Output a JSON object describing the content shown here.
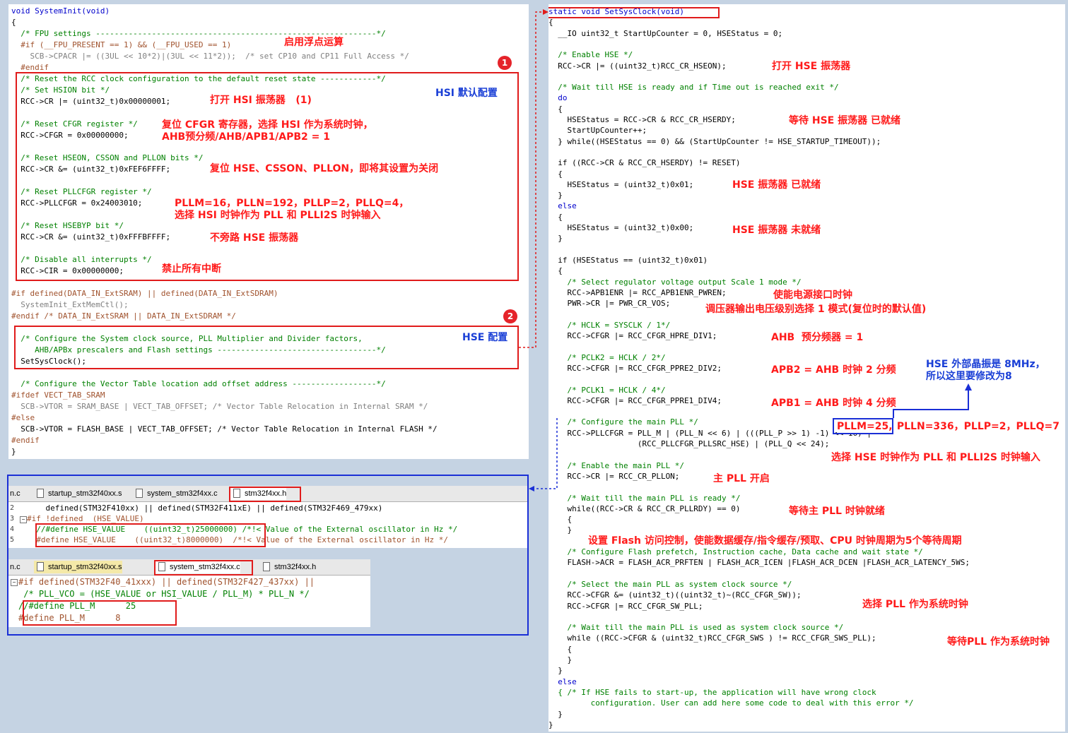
{
  "left_panel": {
    "lines": [
      {
        "t": "void SystemInit(void)",
        "c": "kw"
      },
      {
        "t": "{",
        "c": "tx"
      },
      {
        "t": "  /* FPU settings ------------------------------------------------------------*/",
        "c": "cm"
      },
      {
        "t": "  #if (__FPU_PRESENT == 1) && (__FPU_USED == 1)",
        "c": "pp"
      },
      {
        "t": "    SCB->CPACR |= ((3UL << 10*2)|(3UL << 11*2));  /* set CP10 and CP11 Full Access */",
        "c": "gr"
      },
      {
        "t": "  #endif",
        "c": "pp"
      },
      {
        "t": "  /* Reset the RCC clock configuration to the default reset state ------------*/",
        "c": "cm"
      },
      {
        "t": "  /* Set HSION bit */",
        "c": "cm"
      },
      {
        "t": "  RCC->CR |= (uint32_t)0x00000001;",
        "c": "tx"
      },
      {
        "t": "",
        "c": "tx"
      },
      {
        "t": "  /* Reset CFGR register */",
        "c": "cm"
      },
      {
        "t": "  RCC->CFGR = 0x00000000;",
        "c": "tx"
      },
      {
        "t": "",
        "c": "tx"
      },
      {
        "t": "  /* Reset HSEON, CSSON and PLLON bits */",
        "c": "cm"
      },
      {
        "t": "  RCC->CR &= (uint32_t)0xFEF6FFFF;",
        "c": "tx"
      },
      {
        "t": "",
        "c": "tx"
      },
      {
        "t": "  /* Reset PLLCFGR register */",
        "c": "cm"
      },
      {
        "t": "  RCC->PLLCFGR = 0x24003010;",
        "c": "tx"
      },
      {
        "t": "",
        "c": "tx"
      },
      {
        "t": "  /* Reset HSEBYP bit */",
        "c": "cm"
      },
      {
        "t": "  RCC->CR &= (uint32_t)0xFFFBFFFF;",
        "c": "tx"
      },
      {
        "t": "",
        "c": "tx"
      },
      {
        "t": "  /* Disable all interrupts */",
        "c": "cm"
      },
      {
        "t": "  RCC->CIR = 0x00000000;",
        "c": "tx"
      },
      {
        "t": "",
        "c": "tx"
      },
      {
        "t": "#if defined(DATA_IN_ExtSRAM) || defined(DATA_IN_ExtSDRAM)",
        "c": "pp"
      },
      {
        "t": "  SystemInit_ExtMemCtl();",
        "c": "gr"
      },
      {
        "t": "#endif /* DATA_IN_ExtSRAM || DATA_IN_ExtSDRAM */",
        "c": "pp"
      },
      {
        "t": "",
        "c": "tx"
      },
      {
        "t": "  /* Configure the System clock source, PLL Multiplier and Divider factors,",
        "c": "cm"
      },
      {
        "t": "     AHB/APBx prescalers and Flash settings ----------------------------------*/",
        "c": "cm"
      },
      {
        "t": "  SetSysClock();",
        "c": "tx"
      },
      {
        "t": "",
        "c": "tx"
      },
      {
        "t": "  /* Configure the Vector Table location add offset address ------------------*/",
        "c": "cm"
      },
      {
        "t": "#ifdef VECT_TAB_SRAM",
        "c": "pp"
      },
      {
        "t": "  SCB->VTOR = SRAM_BASE | VECT_TAB_OFFSET; /* Vector Table Relocation in Internal SRAM */",
        "c": "gr"
      },
      {
        "t": "#else",
        "c": "pp"
      },
      {
        "t": "  SCB->VTOR = FLASH_BASE | VECT_TAB_OFFSET; /* Vector Table Relocation in Internal FLASH */",
        "c": "tx"
      },
      {
        "t": "#endif",
        "c": "pp"
      },
      {
        "t": "}",
        "c": "tx"
      }
    ],
    "annotations": {
      "fpu": "启用浮点运算",
      "hsi_on": "打开 HSI 振荡器   (1)",
      "hsi_title": "HSI 默认配置",
      "cfgr": "复位 CFGR 寄存器，选择 HSI 作为系统时钟，\nAHB预分频/AHB/APB1/APB2 = 1",
      "hseon": "复位 HSE、CSSON、PLLON，即将其设置为关闭",
      "pllcfgr": "PLLM=16，PLLN=192，PLLP=2，PLLQ=4，\n选择 HSI 时钟作为 PLL 和 PLLI2S 时钟输入",
      "hsebyp": "不旁路 HSE 振荡器",
      "cir": "禁止所有中断",
      "hse_title": "HSE 配置"
    },
    "badges": [
      "1",
      "2"
    ]
  },
  "right_panel": {
    "lines": [
      {
        "t": "static void SetSysClock(void)",
        "c": "kw"
      },
      {
        "t": "{",
        "c": "tx"
      },
      {
        "t": "  __IO uint32_t StartUpCounter = 0, HSEStatus = 0;",
        "c": "tx"
      },
      {
        "t": "",
        "c": "tx"
      },
      {
        "t": "  /* Enable HSE */",
        "c": "cm"
      },
      {
        "t": "  RCC->CR |= ((uint32_t)RCC_CR_HSEON);",
        "c": "tx"
      },
      {
        "t": "",
        "c": "tx"
      },
      {
        "t": "  /* Wait till HSE is ready and if Time out is reached exit */",
        "c": "cm"
      },
      {
        "t": "  do",
        "c": "kw"
      },
      {
        "t": "  {",
        "c": "tx"
      },
      {
        "t": "    HSEStatus = RCC->CR & RCC_CR_HSERDY;",
        "c": "tx"
      },
      {
        "t": "    StartUpCounter++;",
        "c": "tx"
      },
      {
        "t": "  } while((HSEStatus == 0) && (StartUpCounter != HSE_STARTUP_TIMEOUT));",
        "c": "tx"
      },
      {
        "t": "",
        "c": "tx"
      },
      {
        "t": "  if ((RCC->CR & RCC_CR_HSERDY) != RESET)",
        "c": "tx"
      },
      {
        "t": "  {",
        "c": "tx"
      },
      {
        "t": "    HSEStatus = (uint32_t)0x01;",
        "c": "tx"
      },
      {
        "t": "  }",
        "c": "tx"
      },
      {
        "t": "  else",
        "c": "kw"
      },
      {
        "t": "  {",
        "c": "tx"
      },
      {
        "t": "    HSEStatus = (uint32_t)0x00;",
        "c": "tx"
      },
      {
        "t": "  }",
        "c": "tx"
      },
      {
        "t": "",
        "c": "tx"
      },
      {
        "t": "  if (HSEStatus == (uint32_t)0x01)",
        "c": "tx"
      },
      {
        "t": "  {",
        "c": "tx"
      },
      {
        "t": "    /* Select regulator voltage output Scale 1 mode */",
        "c": "cm"
      },
      {
        "t": "    RCC->APB1ENR |= RCC_APB1ENR_PWREN;",
        "c": "tx"
      },
      {
        "t": "    PWR->CR |= PWR_CR_VOS;",
        "c": "tx"
      },
      {
        "t": "",
        "c": "tx"
      },
      {
        "t": "    /* HCLK = SYSCLK / 1*/",
        "c": "cm"
      },
      {
        "t": "    RCC->CFGR |= RCC_CFGR_HPRE_DIV1;",
        "c": "tx"
      },
      {
        "t": "",
        "c": "tx"
      },
      {
        "t": "    /* PCLK2 = HCLK / 2*/",
        "c": "cm"
      },
      {
        "t": "    RCC->CFGR |= RCC_CFGR_PPRE2_DIV2;",
        "c": "tx"
      },
      {
        "t": "",
        "c": "tx"
      },
      {
        "t": "    /* PCLK1 = HCLK / 4*/",
        "c": "cm"
      },
      {
        "t": "    RCC->CFGR |= RCC_CFGR_PPRE1_DIV4;",
        "c": "tx"
      },
      {
        "t": "",
        "c": "tx"
      },
      {
        "t": "    /* Configure the main PLL */",
        "c": "cm"
      },
      {
        "t": "    RCC->PLLCFGR = PLL_M | (PLL_N << 6) | (((PLL_P >> 1) -1) << 16) |",
        "c": "tx"
      },
      {
        "t": "                   (RCC_PLLCFGR_PLLSRC_HSE) | (PLL_Q << 24);",
        "c": "tx"
      },
      {
        "t": "",
        "c": "tx"
      },
      {
        "t": "    /* Enable the main PLL */",
        "c": "cm"
      },
      {
        "t": "    RCC->CR |= RCC_CR_PLLON;",
        "c": "tx"
      },
      {
        "t": "",
        "c": "tx"
      },
      {
        "t": "    /* Wait till the main PLL is ready */",
        "c": "cm"
      },
      {
        "t": "    while((RCC->CR & RCC_CR_PLLRDY) == 0)",
        "c": "tx"
      },
      {
        "t": "    {",
        "c": "tx"
      },
      {
        "t": "    }",
        "c": "tx"
      },
      {
        "t": "",
        "c": "tx"
      },
      {
        "t": "    /* Configure Flash prefetch, Instruction cache, Data cache and wait state */",
        "c": "cm"
      },
      {
        "t": "    FLASH->ACR = FLASH_ACR_PRFTEN | FLASH_ACR_ICEN |FLASH_ACR_DCEN |FLASH_ACR_LATENCY_5WS;",
        "c": "tx"
      },
      {
        "t": "",
        "c": "tx"
      },
      {
        "t": "    /* Select the main PLL as system clock source */",
        "c": "cm"
      },
      {
        "t": "    RCC->CFGR &= (uint32_t)((uint32_t)~(RCC_CFGR_SW));",
        "c": "tx"
      },
      {
        "t": "    RCC->CFGR |= RCC_CFGR_SW_PLL;",
        "c": "tx"
      },
      {
        "t": "",
        "c": "tx"
      },
      {
        "t": "    /* Wait till the main PLL is used as system clock source */",
        "c": "cm"
      },
      {
        "t": "    while ((RCC->CFGR & (uint32_t)RCC_CFGR_SWS ) != RCC_CFGR_SWS_PLL);",
        "c": "tx"
      },
      {
        "t": "    {",
        "c": "tx"
      },
      {
        "t": "    }",
        "c": "tx"
      },
      {
        "t": "  }",
        "c": "tx"
      },
      {
        "t": "  else",
        "c": "kw"
      },
      {
        "t": "  { /* If HSE fails to start-up, the application will have wrong clock",
        "c": "cm"
      },
      {
        "t": "         configuration. User can add here some code to deal with this error */",
        "c": "cm"
      },
      {
        "t": "  }",
        "c": "tx"
      },
      {
        "t": "}",
        "c": "tx"
      }
    ],
    "annotations": {
      "hse_on": "打开 HSE 振荡器",
      "hse_ready1": "等待 HSE 振荡器 已就绪",
      "hse_ready2": "HSE 振荡器 已就绪",
      "hse_notready": "HSE 振荡器 未就绪",
      "pwr_clk": "使能电源接口时钟",
      "vos": "调压器输出电压级别选择 1 模式(复位时的默认值)",
      "ahb": "AHB  预分频器 = 1",
      "apb2": "APB2 = AHB 时钟 2 分频",
      "apb1": "APB1 = AHB 时钟 4 分频",
      "pllm": "PLLM=25,",
      "pll_rest": " PLLN=336，PLLP=2，PLLQ=7",
      "pll_src": "选择 HSE 时钟作为 PLL 和 PLLI2S 时钟输入",
      "pll_on": "主 PLL 开启",
      "pll_ready": "等待主 PLL 时钟就绪",
      "flash": "设置 Flash 访问控制，使能数据缓存/指令缓存/预取、CPU 时钟周期为5个等待周期",
      "sw_pll": "选择 PLL 作为系统时钟",
      "sws_wait": "等待PLL 作为系统时钟",
      "hse_xtal": "HSE 外部晶振是 8MHz，\n所以这里要修改为8"
    }
  },
  "bottom_panel": {
    "tabs1": [
      {
        "label": "n.c",
        "style": "plain"
      },
      {
        "label": "startup_stm32f40xx.s",
        "style": "plain"
      },
      {
        "label": "system_stm32f4xx.c",
        "style": "plain"
      },
      {
        "label": "stm32f4xx.h",
        "style": "active"
      }
    ],
    "lines1": [
      {
        "n": "2",
        "t": "    defined(STM32F410xx) || defined(STM32F411xE) || defined(STM32F469_479xx)",
        "c": "tx"
      },
      {
        "n": "3",
        "t": "#if !defined  (HSE_VALUE)",
        "c": "pp"
      },
      {
        "n": "4",
        "t": "  //#define HSE_VALUE    ((uint32_t)25000000) /*!< Value of the External oscillator in Hz */",
        "c": "cm"
      },
      {
        "n": "5",
        "t": "  #define HSE_VALUE    ((uint32_t)8000000)  /*!< Value of the External oscillator in Hz */",
        "c": "pp"
      }
    ],
    "tabs2": [
      {
        "label": "n.c",
        "style": "plain"
      },
      {
        "label": "startup_stm32f40xx.s",
        "style": "yel"
      },
      {
        "label": "system_stm32f4xx.c",
        "style": "active"
      },
      {
        "label": "stm32f4xx.h",
        "style": "plain"
      }
    ],
    "lines2": [
      {
        "t": "#if defined(STM32F40_41xxx) || defined(STM32F427_437xx) ||",
        "c": "pp"
      },
      {
        "t": " /* PLL_VCO = (HSE_VALUE or HSI_VALUE / PLL_M) * PLL_N */",
        "c": "cm"
      },
      {
        "t": "//#define PLL_M      25",
        "c": "cm"
      },
      {
        "t": "#define PLL_M      8",
        "c": "pp"
      }
    ]
  },
  "colors": {
    "accent_red": "#e01b1b",
    "accent_blue": "#1a2fd6",
    "background": "#c5d3e3"
  }
}
